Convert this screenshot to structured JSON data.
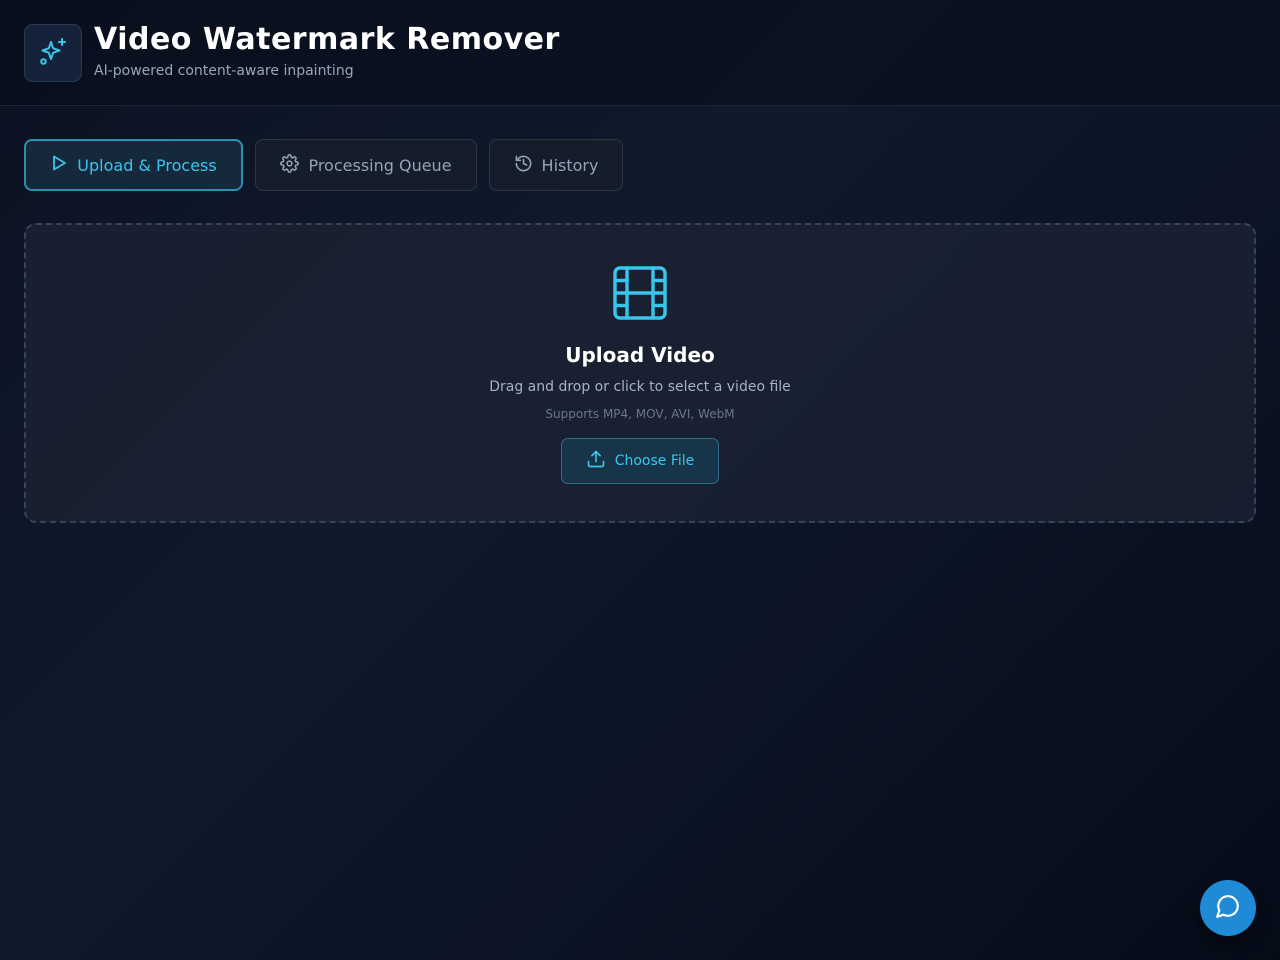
{
  "header": {
    "title": "Video Watermark Remover",
    "subtitle": "AI-powered content-aware inpainting",
    "logo_icon": "sparkles-icon"
  },
  "tabs": [
    {
      "label": "Upload & Process",
      "icon": "play-icon",
      "active": true
    },
    {
      "label": "Processing Queue",
      "icon": "gear-icon",
      "active": false
    },
    {
      "label": "History",
      "icon": "history-icon",
      "active": false
    }
  ],
  "upload": {
    "icon": "film-icon",
    "title": "Upload Video",
    "hint": "Drag and drop or click to select a video file",
    "formats": "Supports MP4, MOV, AVI, WebM",
    "button_label": "Choose File",
    "button_icon": "upload-icon"
  },
  "chat": {
    "icon": "chat-bubble-icon"
  },
  "colors": {
    "accent": "#38c6ec",
    "background": "#0b1222",
    "fab": "#1f8ad6"
  }
}
